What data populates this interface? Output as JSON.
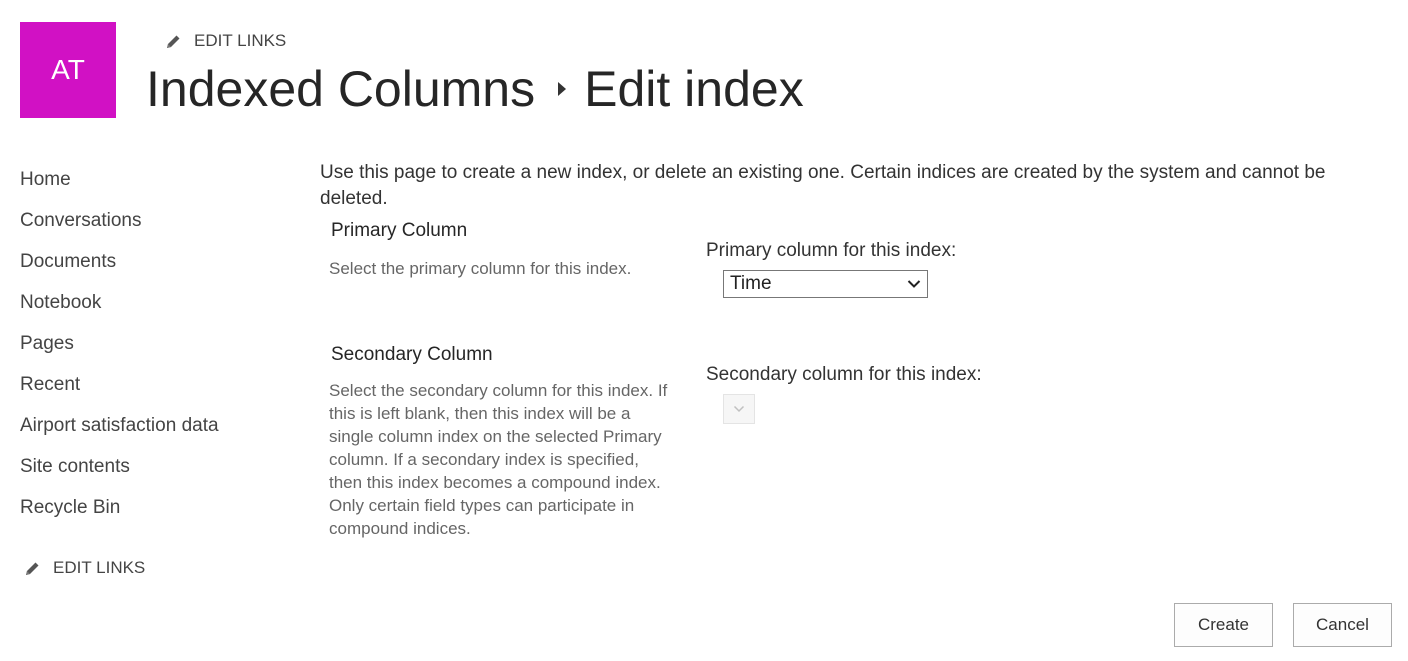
{
  "site": {
    "logo_initials": "AT",
    "logo_color": "#d111c4"
  },
  "header": {
    "edit_links_label": "EDIT LINKS",
    "breadcrumb_parent": "Indexed Columns",
    "breadcrumb_current": "Edit index",
    "separator_icon": "breadcrumb-arrow-icon"
  },
  "quick_launch": {
    "items": [
      {
        "label": "Home"
      },
      {
        "label": "Conversations"
      },
      {
        "label": "Documents"
      },
      {
        "label": "Notebook"
      },
      {
        "label": "Pages"
      },
      {
        "label": "Recent"
      },
      {
        "label": "Airport satisfaction data"
      },
      {
        "label": "Site contents"
      },
      {
        "label": "Recycle Bin"
      }
    ],
    "edit_links_label": "EDIT LINKS"
  },
  "main": {
    "intro": "Use this page to create a new index, or delete an existing one. Certain indices are created by the system and cannot be deleted.",
    "primary": {
      "title": "Primary Column",
      "description": "Select the primary column for this index.",
      "field_label": "Primary column for this index:",
      "selected_value": "Time"
    },
    "secondary": {
      "title": "Secondary Column",
      "description": "Select the secondary column for this index. If this is left blank, then this index will be a single column index on the selected Primary column. If a secondary index is specified, then this index becomes a compound index. Only certain field types can participate in compound indices.",
      "field_label": "Secondary column for this index:",
      "selected_value": ""
    }
  },
  "actions": {
    "create_label": "Create",
    "cancel_label": "Cancel"
  }
}
